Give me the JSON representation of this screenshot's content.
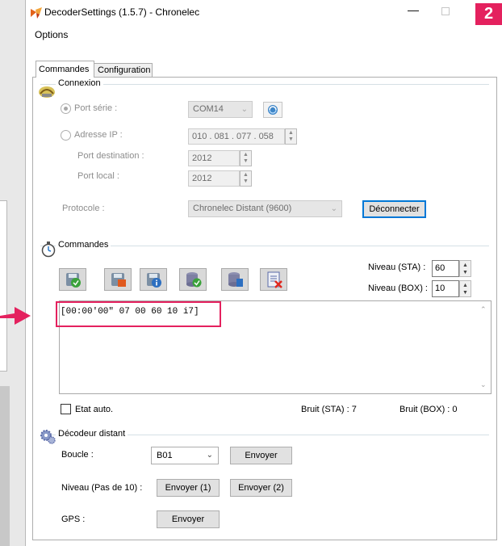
{
  "window": {
    "title": "DecoderSettings (1.5.7) - Chronelec",
    "minimize_glyph": "—",
    "step_badge": "2"
  },
  "menu": {
    "options": "Options"
  },
  "tabs": {
    "commandes": "Commandes",
    "configuration": "Configuration"
  },
  "connexion": {
    "title": "Connexion",
    "port_serie_label": "Port série :",
    "port_serie_value": "COM14",
    "adresse_ip_label": "Adresse IP :",
    "adresse_ip_value": "010 . 081 . 077 . 058",
    "port_destination_label": "Port destination :",
    "port_destination_value": "2012",
    "port_local_label": "Port local :",
    "port_local_value": "2012",
    "protocole_label": "Protocole :",
    "protocole_value": "Chronelec Distant (9600)",
    "deconnecter_label": "Déconnecter"
  },
  "commandes": {
    "title": "Commandes",
    "niveau_sta_label": "Niveau (STA) :",
    "niveau_sta_value": "60",
    "niveau_box_label": "Niveau (BOX) :",
    "niveau_box_value": "10",
    "log_line": "[00:00'00\" 07 00 60 10 i7]",
    "etat_auto_label": "Etat auto.",
    "bruit_sta": "Bruit (STA) : 7",
    "bruit_box": "Bruit (BOX) : 0"
  },
  "decodeur": {
    "title": "Décodeur distant",
    "boucle_label": "Boucle :",
    "boucle_value": "B01",
    "boucle_send": "Envoyer",
    "niveau_label": "Niveau (Pas de 10) :",
    "niveau_send1": "Envoyer (1)",
    "niveau_send2": "Envoyer (2)",
    "gps_label": "GPS :",
    "gps_send": "Envoyer"
  },
  "colors": {
    "highlight": "#e4215e",
    "focus": "#0078d7"
  }
}
